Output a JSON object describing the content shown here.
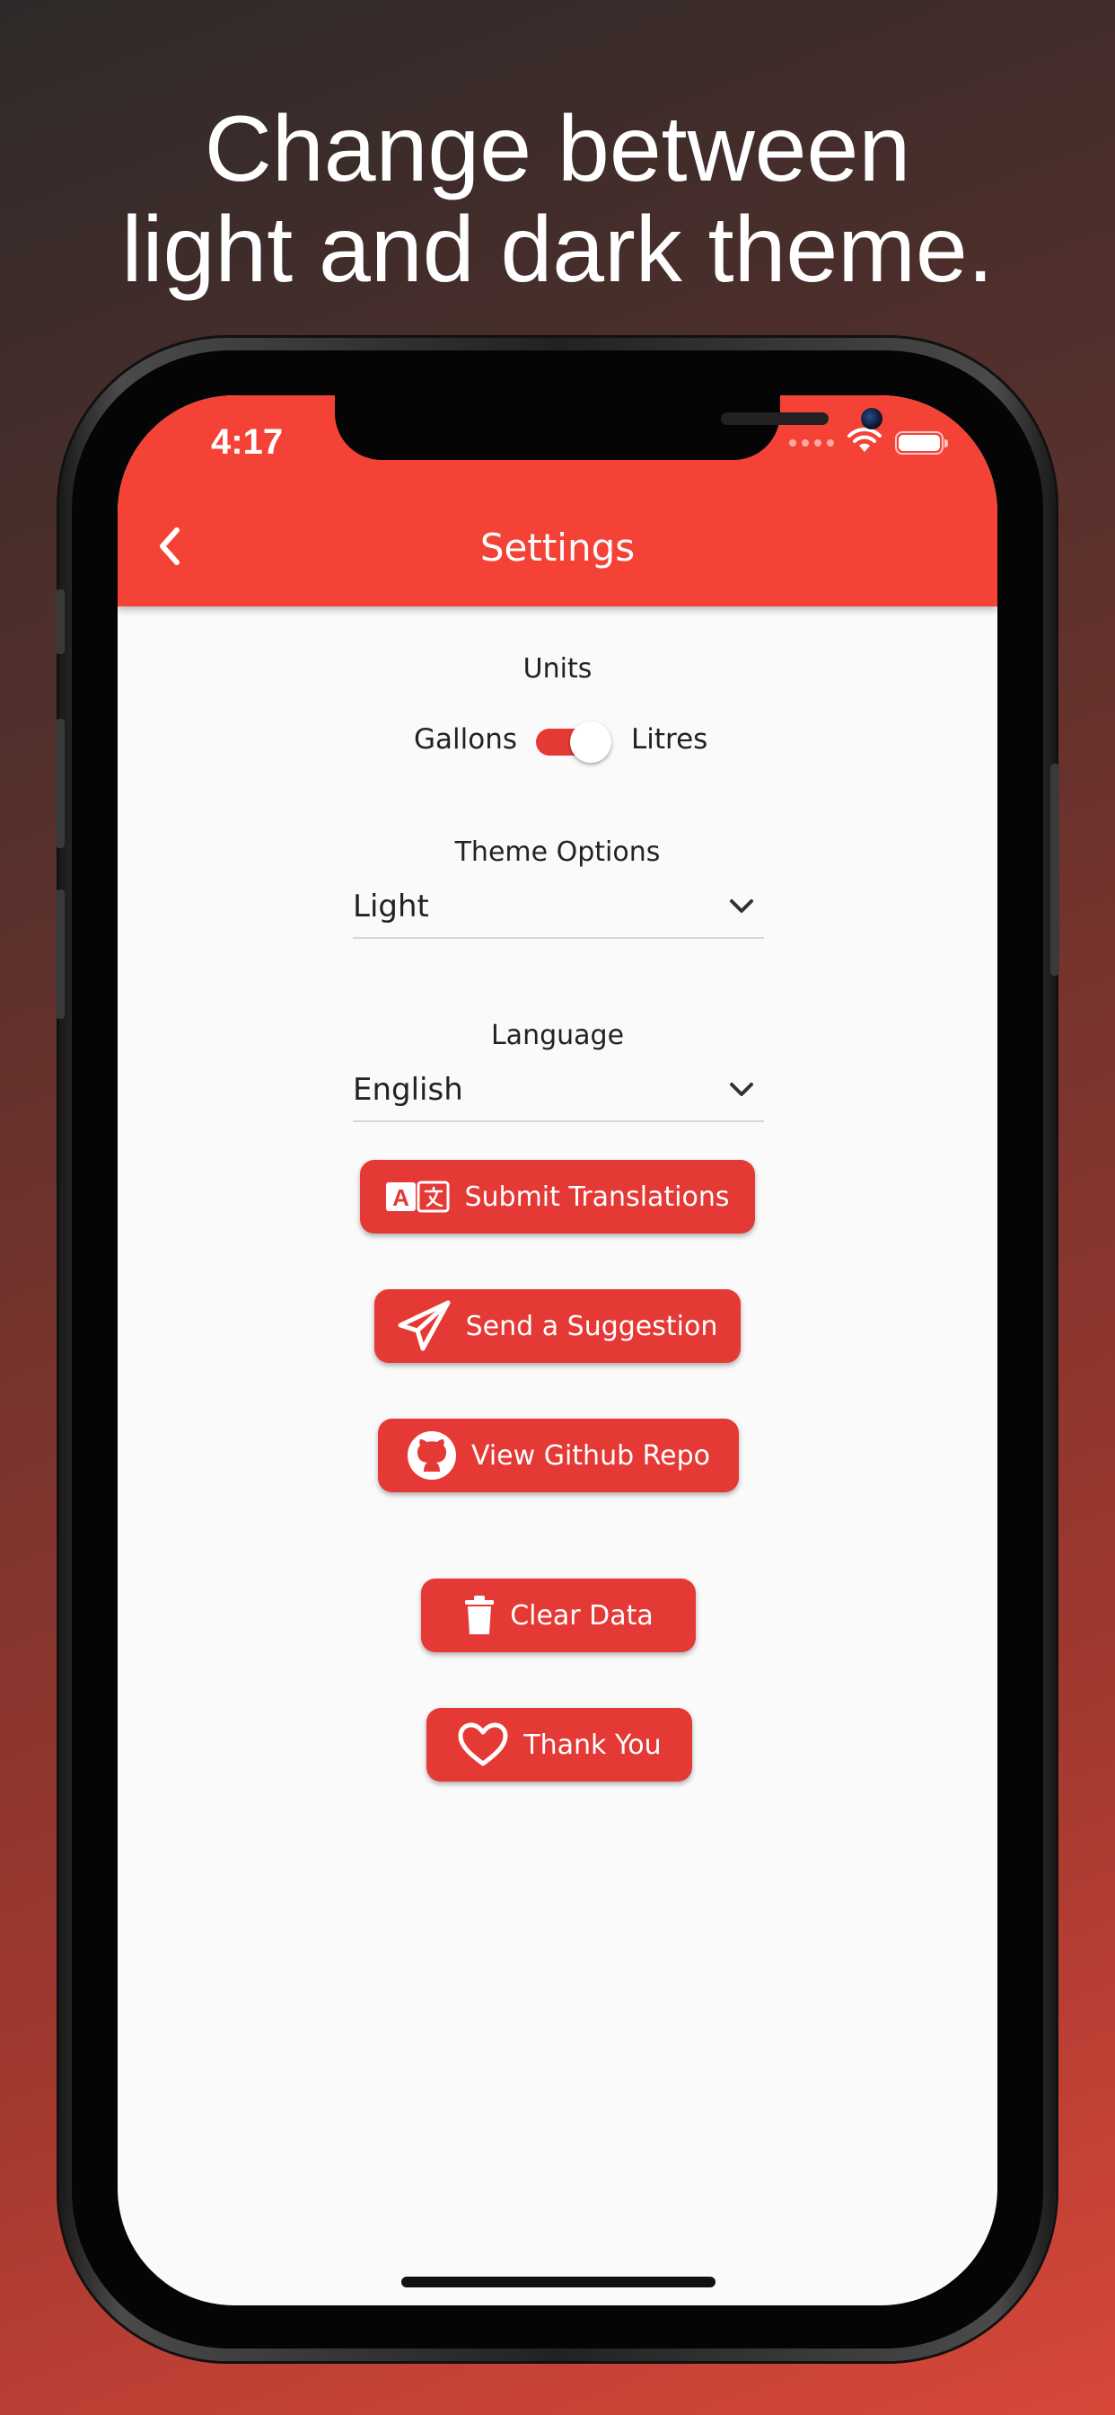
{
  "headline": {
    "line1": "Change between",
    "line2": "light and dark theme."
  },
  "status_bar": {
    "time": "4:17"
  },
  "app_bar": {
    "title": "Settings"
  },
  "units": {
    "label": "Units",
    "left_option": "Gallons",
    "right_option": "Litres",
    "toggle_on": true
  },
  "theme": {
    "label": "Theme Options",
    "selected": "Light"
  },
  "language": {
    "label": "Language",
    "selected": "English"
  },
  "buttons": {
    "submit_translations": "Submit Translations",
    "send_suggestion": "Send a Suggestion",
    "view_github": "View Github Repo",
    "clear_data": "Clear Data",
    "thank_you": "Thank You"
  },
  "colors": {
    "accent": "#f44336",
    "button": "#e53935",
    "background": "#fafafa"
  },
  "icons": {
    "back": "chevron-left-icon",
    "dropdown": "chevron-down-icon",
    "translate": "translate-icon",
    "send": "paper-plane-icon",
    "github": "github-icon",
    "trash": "trash-icon",
    "heart": "heart-icon",
    "wifi": "wifi-icon",
    "battery": "battery-icon"
  }
}
